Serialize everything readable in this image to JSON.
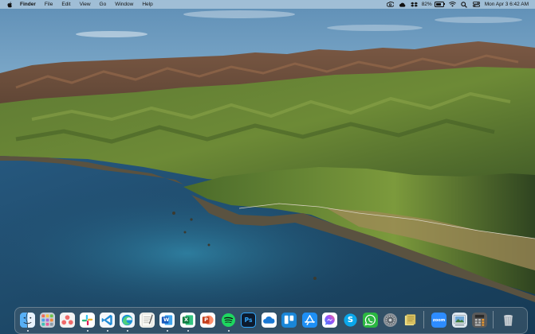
{
  "menubar": {
    "app_name": "Finder",
    "menus": [
      "File",
      "Edit",
      "View",
      "Go",
      "Window",
      "Help"
    ],
    "battery_percent": "82%",
    "battery_level": 0.82,
    "datetime": "Mon Apr 3  6:42 AM",
    "status_icons": [
      "creative-cloud-icon",
      "cloud-icon",
      "dropbox-icon",
      "battery-icon",
      "wifi-icon",
      "search-icon",
      "control-center-icon"
    ]
  },
  "desktop": {
    "wallpaper": "macOS Big Sur coastline",
    "colors": {
      "sky": "#9fc6de",
      "sea": "#1f4a6a",
      "hills": "#4e6a2c",
      "ridge": "#7a5a3e"
    }
  },
  "dock": {
    "apps": [
      {
        "name": "finder-icon",
        "label": "",
        "bg": "#3f9bf0"
      },
      {
        "name": "launchpad-icon",
        "label": "",
        "bg": "#c8d0d8"
      },
      {
        "name": "asana-icon",
        "label": "",
        "bg": "#f3f3f3"
      },
      {
        "name": "slack-icon",
        "label": "",
        "bg": "#ffffff"
      },
      {
        "name": "vscode-icon",
        "label": "",
        "bg": "#f5f7fa"
      },
      {
        "name": "edge-icon",
        "label": "",
        "bg": "#f0f5fa"
      },
      {
        "name": "textedit-icon",
        "label": "",
        "bg": "#f4f4f0"
      },
      {
        "name": "word-icon",
        "label": "W",
        "bg": "#ffffff"
      },
      {
        "name": "excel-icon",
        "label": "X",
        "bg": "#ffffff"
      },
      {
        "name": "powerpoint-icon",
        "label": "P",
        "bg": "#ffffff"
      },
      {
        "name": "spotify-icon",
        "label": "",
        "bg": "#1ed760"
      },
      {
        "name": "photoshop-icon",
        "label": "Ps",
        "bg": "#0d1b2e"
      },
      {
        "name": "onedrive-icon",
        "label": "",
        "bg": "#ffffff"
      },
      {
        "name": "trello-icon",
        "label": "",
        "bg": "#1a86d8"
      },
      {
        "name": "app-store-icon",
        "label": "",
        "bg": "#1e8ff5"
      },
      {
        "name": "messenger-icon",
        "label": "",
        "bg": "#ffffff"
      },
      {
        "name": "skype-icon",
        "label": "S",
        "bg": "#0aa7ea"
      },
      {
        "name": "whatsapp-icon",
        "label": "",
        "bg": "#2bb741"
      },
      {
        "name": "system-preferences-icon",
        "label": "",
        "bg": "#8e959c"
      },
      {
        "name": "notes-icon",
        "label": "",
        "bg": "#d8c570"
      },
      {
        "name": "zoom-icon",
        "label": "zoom",
        "bg": "#2d8cff"
      },
      {
        "name": "preview-icon",
        "label": "",
        "bg": "#dfe8ef"
      },
      {
        "name": "calculator-icon",
        "label": "",
        "bg": "#5a5a5a"
      },
      {
        "name": "trash-icon",
        "label": "",
        "bg": "transparent"
      }
    ]
  }
}
